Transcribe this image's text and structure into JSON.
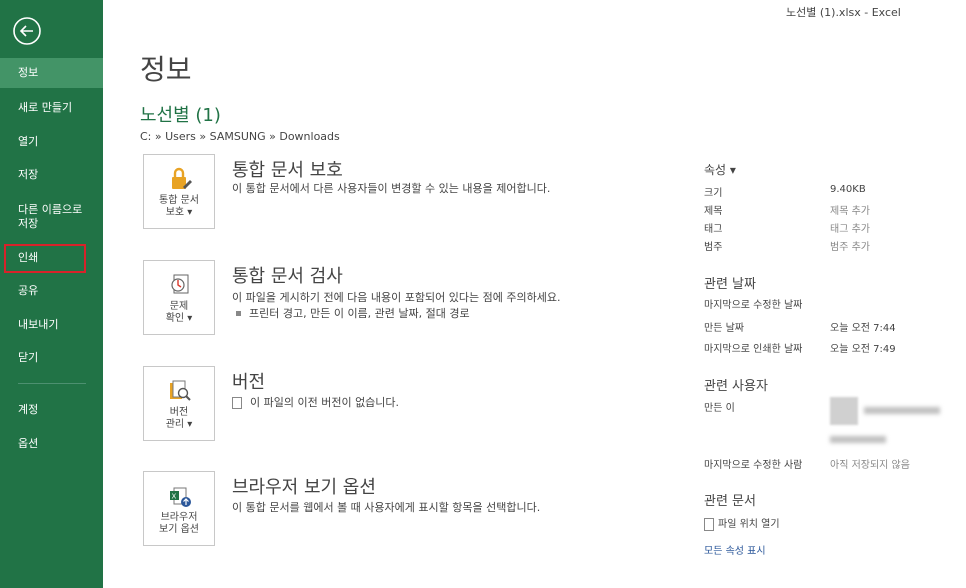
{
  "window": {
    "title": "노선별 (1).xlsx - Excel"
  },
  "sidebar": {
    "items": [
      {
        "label": "정보"
      },
      {
        "label": "새로 만들기"
      },
      {
        "label": "열기"
      },
      {
        "label": "저장"
      },
      {
        "label": "다른 이름으로\n저장"
      },
      {
        "label": "인쇄"
      },
      {
        "label": "공유"
      },
      {
        "label": "내보내기"
      },
      {
        "label": "닫기"
      },
      {
        "label": "계정"
      },
      {
        "label": "옵션"
      }
    ],
    "active_index": 0,
    "highlighted_index": 5
  },
  "main": {
    "title": "정보",
    "doc_name": "노선별 (1)",
    "path": "C: » Users » SAMSUNG » Downloads",
    "sections": [
      {
        "tile_label": "통합 문서\n보호 ▾",
        "title": "통합 문서 보호",
        "desc": "이 통합 문서에서 다른 사용자들이 변경할 수 있는 내용을 제어합니다."
      },
      {
        "tile_label": "문제\n확인 ▾",
        "title": "통합 문서 검사",
        "desc": "이 파일을 게시하기 전에 다음 내용이 포함되어 있다는 점에 주의하세요.",
        "bullet": "프린터 경고, 만든 이 이름, 관련 날짜, 절대 경로"
      },
      {
        "tile_label": "버전\n관리 ▾",
        "title": "버전",
        "desc": "이 파일의 이전 버전이 없습니다."
      },
      {
        "tile_label": "브라우저\n보기 옵션",
        "title": "브라우저 보기 옵션",
        "desc": "이 통합 문서를 웹에서 볼 때 사용자에게 표시할 항목을 선택합니다."
      }
    ]
  },
  "properties": {
    "heading": "속성 ▾",
    "rows": [
      {
        "key": "크기",
        "value": "9.40KB"
      },
      {
        "key": "제목",
        "value": "제목 추가"
      },
      {
        "key": "태그",
        "value": "태그 추가"
      },
      {
        "key": "범주",
        "value": "범주 추가"
      }
    ],
    "dates_heading": "관련 날짜",
    "dates": [
      {
        "key": "마지막으로 수정한 날짜",
        "value": ""
      },
      {
        "key": "만든 날짜",
        "value": "오늘 오전 7:44"
      },
      {
        "key": "마지막으로 인쇄한 날짜",
        "value": "오늘 오전 7:49"
      }
    ],
    "people_heading": "관련 사용자",
    "author_key": "만든 이",
    "modifier_key": "마지막으로 수정한 사람",
    "modifier_value": "아직 저장되지 않음",
    "docs_heading": "관련 문서",
    "open_location": "파일 위치 열기",
    "show_all": "모든 속성 표시"
  }
}
